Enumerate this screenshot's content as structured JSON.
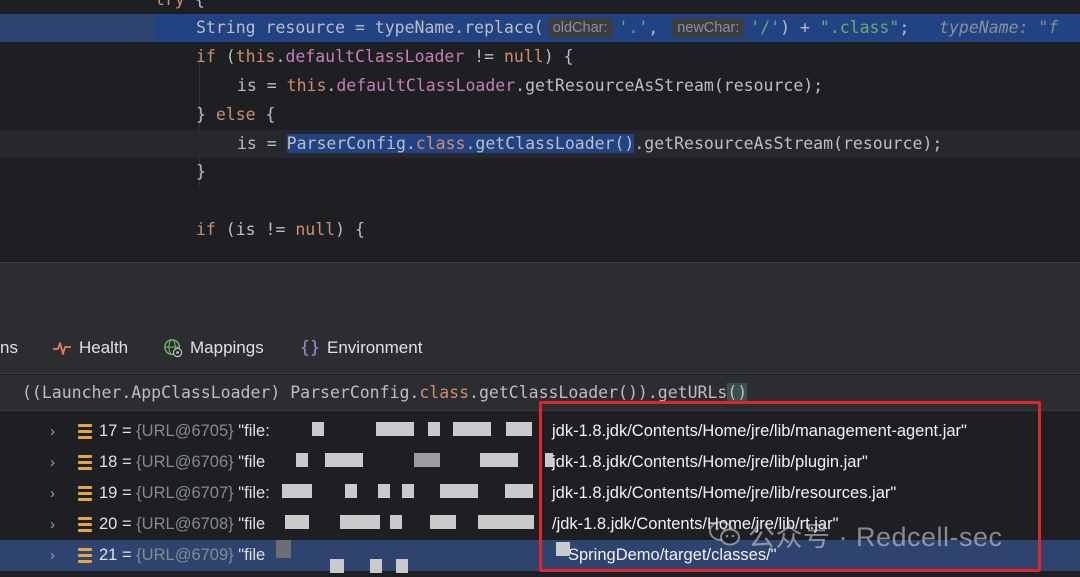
{
  "editor": {
    "lines": [
      {
        "segments": [
          {
            "t": "try",
            "c": "kw"
          },
          {
            "t": " {",
            "c": ""
          }
        ]
      },
      {
        "segments": [
          {
            "t": "String resource = typeName.",
            "c": ""
          },
          {
            "t": "replace",
            "c": ""
          },
          {
            "t": "(",
            "c": ""
          },
          {
            "hint": "oldChar:"
          },
          {
            "t": "'.'",
            "c": "str"
          },
          {
            "t": ", ",
            "c": ""
          },
          {
            "hint": "newChar:"
          },
          {
            "t": "'/'",
            "c": "str"
          },
          {
            "t": ") + ",
            "c": ""
          },
          {
            "t": "\".class\"",
            "c": "str"
          },
          {
            "t": ";   ",
            "c": ""
          },
          {
            "t": "typeName: \"f",
            "c": "inline-val"
          }
        ]
      },
      {
        "segments": [
          {
            "t": "if",
            "c": "kw"
          },
          {
            "t": " (",
            "c": ""
          },
          {
            "t": "this",
            "c": "kw"
          },
          {
            "t": ".",
            "c": ""
          },
          {
            "t": "defaultClassLoader",
            "c": "fld"
          },
          {
            "t": " != ",
            "c": ""
          },
          {
            "t": "null",
            "c": "kw"
          },
          {
            "t": ") {",
            "c": ""
          }
        ]
      },
      {
        "segments": [
          {
            "t": "is = ",
            "c": ""
          },
          {
            "t": "this",
            "c": "kw"
          },
          {
            "t": ".",
            "c": ""
          },
          {
            "t": "defaultClassLoader",
            "c": "fld"
          },
          {
            "t": ".getResourceAsStream(resource);",
            "c": ""
          }
        ]
      },
      {
        "segments": [
          {
            "t": "} ",
            "c": ""
          },
          {
            "t": "else",
            "c": "kw"
          },
          {
            "t": " {",
            "c": ""
          }
        ]
      },
      {
        "segments": [
          {
            "t": "is = ",
            "c": ""
          },
          {
            "t": "ParserConfig.",
            "c": "sel"
          },
          {
            "t": "class",
            "c": "kw sel"
          },
          {
            "t": ".getClassLoader()",
            "c": "sel"
          },
          {
            "t": ".getResourceAsStream(resource);",
            "c": ""
          }
        ]
      },
      {
        "segments": [
          {
            "t": "}",
            "c": ""
          }
        ]
      },
      {
        "segments": []
      },
      {
        "segments": [
          {
            "t": "if",
            "c": "kw"
          },
          {
            "t": " (is != ",
            "c": ""
          },
          {
            "t": "null",
            "c": "kw"
          },
          {
            "t": ") {",
            "c": ""
          }
        ]
      }
    ]
  },
  "tabs": [
    {
      "label": "ns",
      "icon": "tab-partial"
    },
    {
      "label": "Health",
      "icon": "pulse-icon"
    },
    {
      "label": "Mappings",
      "icon": "globe-icon"
    },
    {
      "label": "Environment",
      "icon": "braces-icon"
    }
  ],
  "expression": {
    "prefix": "((Launcher.AppClassLoader) ParserConfig.",
    "kw": "class",
    "suffix": ".getClassLoader()).getURLs",
    "paren": "()"
  },
  "variables": [
    {
      "index": "17",
      "ref": "{URL@6705}",
      "prefix": "\"file:",
      "path": "jdk-1.8.jdk/Contents/Home/jre/lib/management-agent.jar\""
    },
    {
      "index": "18",
      "ref": "{URL@6706}",
      "prefix": "\"file",
      "path": "jdk-1.8.jdk/Contents/Home/jre/lib/plugin.jar\""
    },
    {
      "index": "19",
      "ref": "{URL@6707}",
      "prefix": "\"file:",
      "path": "jdk-1.8.jdk/Contents/Home/jre/lib/resources.jar\""
    },
    {
      "index": "20",
      "ref": "{URL@6708}",
      "prefix": "\"file",
      "path": "/jdk-1.8.jdk/Contents/Home/jre/lib/rt.jar\""
    },
    {
      "index": "21",
      "ref": "{URL@6709}",
      "prefix": "\"file",
      "path": "SpringDemo/target/classes/\""
    }
  ],
  "watermark": {
    "text": "公众号 · Redcell-sec",
    "icon": "wechat-icon"
  },
  "colors": {
    "highlight": "#e0252c",
    "selection": "#214283"
  }
}
